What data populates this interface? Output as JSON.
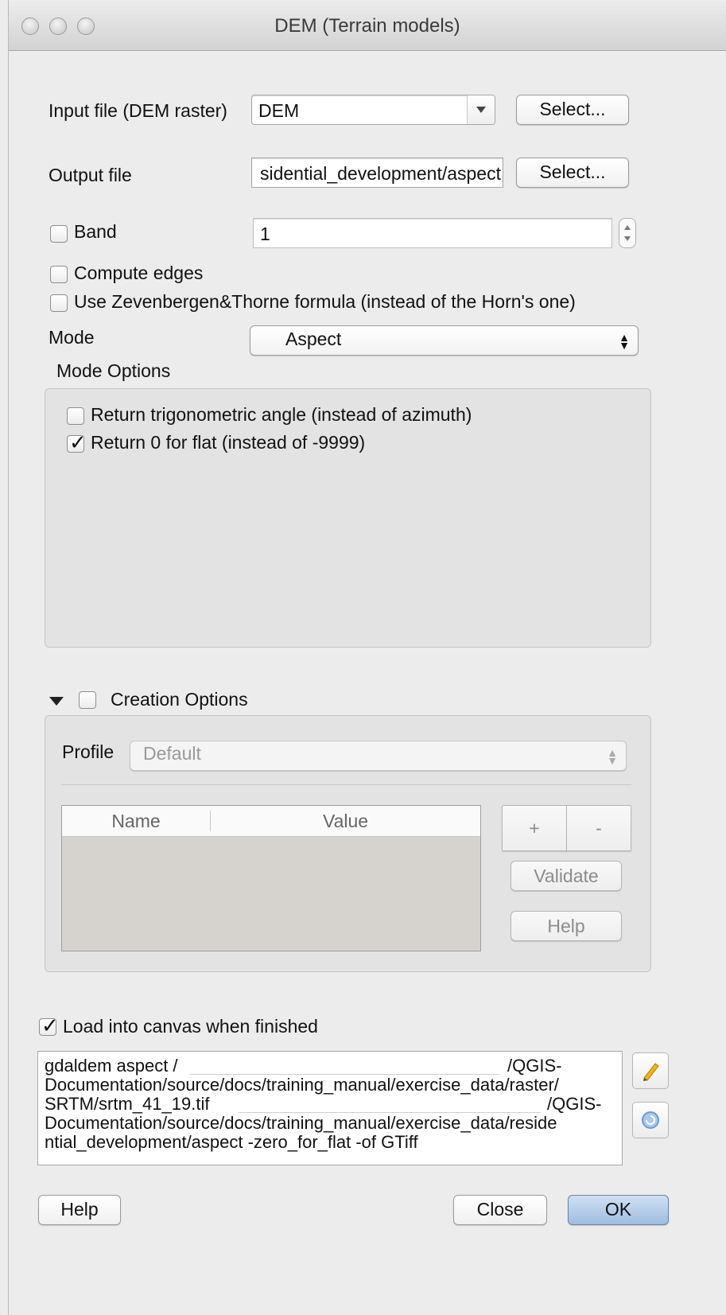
{
  "window": {
    "title": "DEM (Terrain models)"
  },
  "input_file": {
    "label": "Input file (DEM raster)",
    "value": "DEM",
    "select_label": "Select..."
  },
  "output_file": {
    "label": "Output file",
    "value": "sidential_development/aspect",
    "select_label": "Select..."
  },
  "band": {
    "label": "Band",
    "checked": false,
    "value": "1"
  },
  "compute_edges": {
    "label": "Compute edges",
    "checked": false
  },
  "zevenbergen": {
    "label": "Use Zevenbergen&Thorne formula (instead of the Horn's one)",
    "checked": false
  },
  "mode": {
    "label": "Mode",
    "value": "Aspect"
  },
  "mode_options": {
    "title": "Mode Options",
    "trig_angle": {
      "label": "Return trigonometric angle (instead of azimuth)",
      "checked": false
    },
    "zero_flat": {
      "label": "Return 0 for flat (instead of -9999)",
      "checked": true
    }
  },
  "creation_options": {
    "title": "Creation Options",
    "checked": false,
    "profile_label": "Profile",
    "profile_value": "Default",
    "columns": [
      "Name",
      "Value"
    ],
    "add_label": "+",
    "remove_label": "-",
    "validate_label": "Validate",
    "help_label": "Help"
  },
  "load_canvas": {
    "label": "Load into canvas when finished",
    "checked": true
  },
  "command": {
    "line1_prefix": "gdaldem aspect /",
    "line1_suffix": "/QGIS-",
    "line2": "Documentation/source/docs/training_manual/exercise_data/raster/",
    "line3_prefix": "SRTM/srtm_41_19.tif",
    "line3_suffix": "/QGIS-",
    "line4": "Documentation/source/docs/training_manual/exercise_data/reside",
    "line5": "ntial_development/aspect -zero_for_flat -of GTiff"
  },
  "footer": {
    "help_label": "Help",
    "close_label": "Close",
    "ok_label": "OK"
  },
  "icons": {
    "edit": "pencil-icon",
    "reset": "reset-icon"
  }
}
